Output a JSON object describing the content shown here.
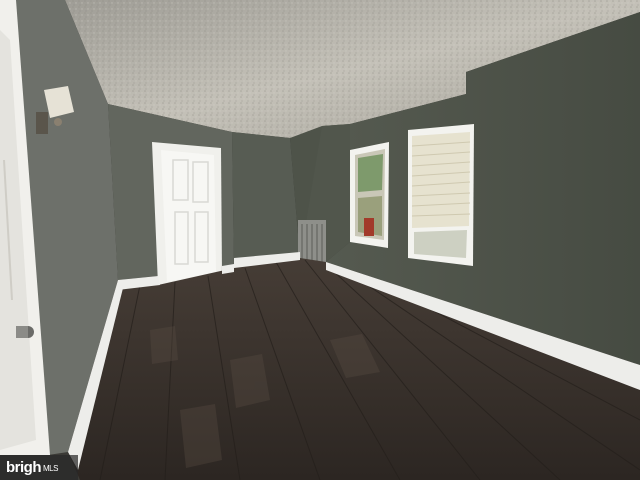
{
  "photo": {
    "subject": "empty-room-interior",
    "colors": {
      "ceiling": "#b9b6ae",
      "wall_left": "#6f726b",
      "wall_back": "#5e635a",
      "wall_right": "#4c5147",
      "floor": "#3a322d",
      "trim": "#f2f2ee",
      "door": "#f5f5f2",
      "window_light": "#e9e6d8"
    }
  },
  "watermark": {
    "brand": "brigh",
    "suffix": "MLS"
  }
}
